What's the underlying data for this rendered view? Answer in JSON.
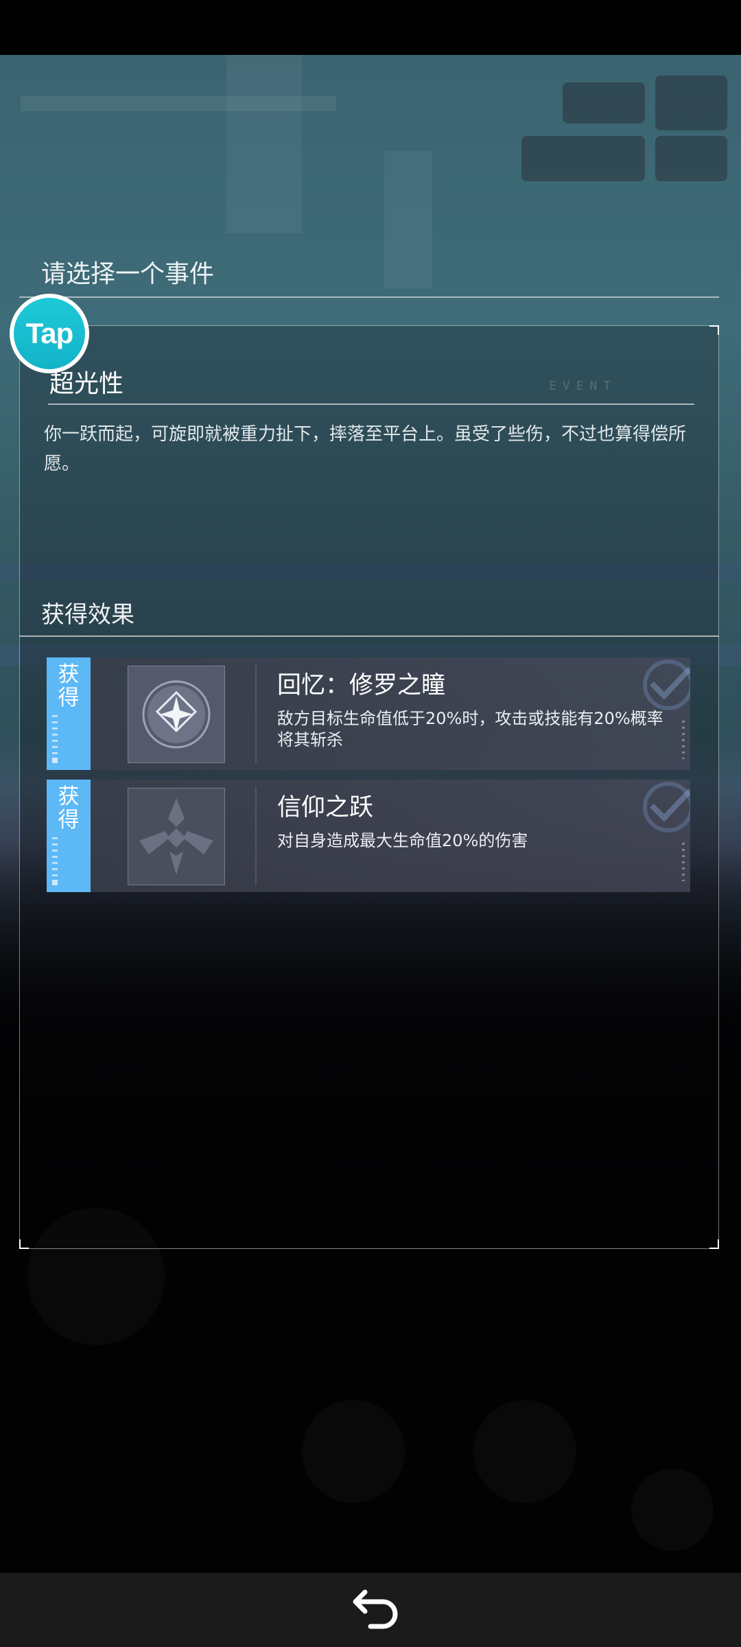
{
  "panel": {
    "title": "请选择一个事件"
  },
  "badge": {
    "label": "Tap"
  },
  "event": {
    "name": "超光性",
    "tag": "EVENT",
    "description": "你一跃而起，可旋即就被重力扯下，摔落至平台上。虽受了些伤，不过也算得偿所愿。"
  },
  "effects_section": {
    "title": "获得效果",
    "items": [
      {
        "tag": "获得",
        "name": "回忆：修罗之瞳",
        "description": "敌方目标生命值低于20%时，攻击或技能有20%概率将其斩杀",
        "icon": "star-compass-icon"
      },
      {
        "tag": "获得",
        "name": "信仰之跃",
        "description": "对自身造成最大生命值20%的伤害",
        "icon": "faith-leap-icon"
      }
    ]
  },
  "colors": {
    "obtain_tag": "#5db8f6",
    "tap_badge": "#13b3c7"
  }
}
